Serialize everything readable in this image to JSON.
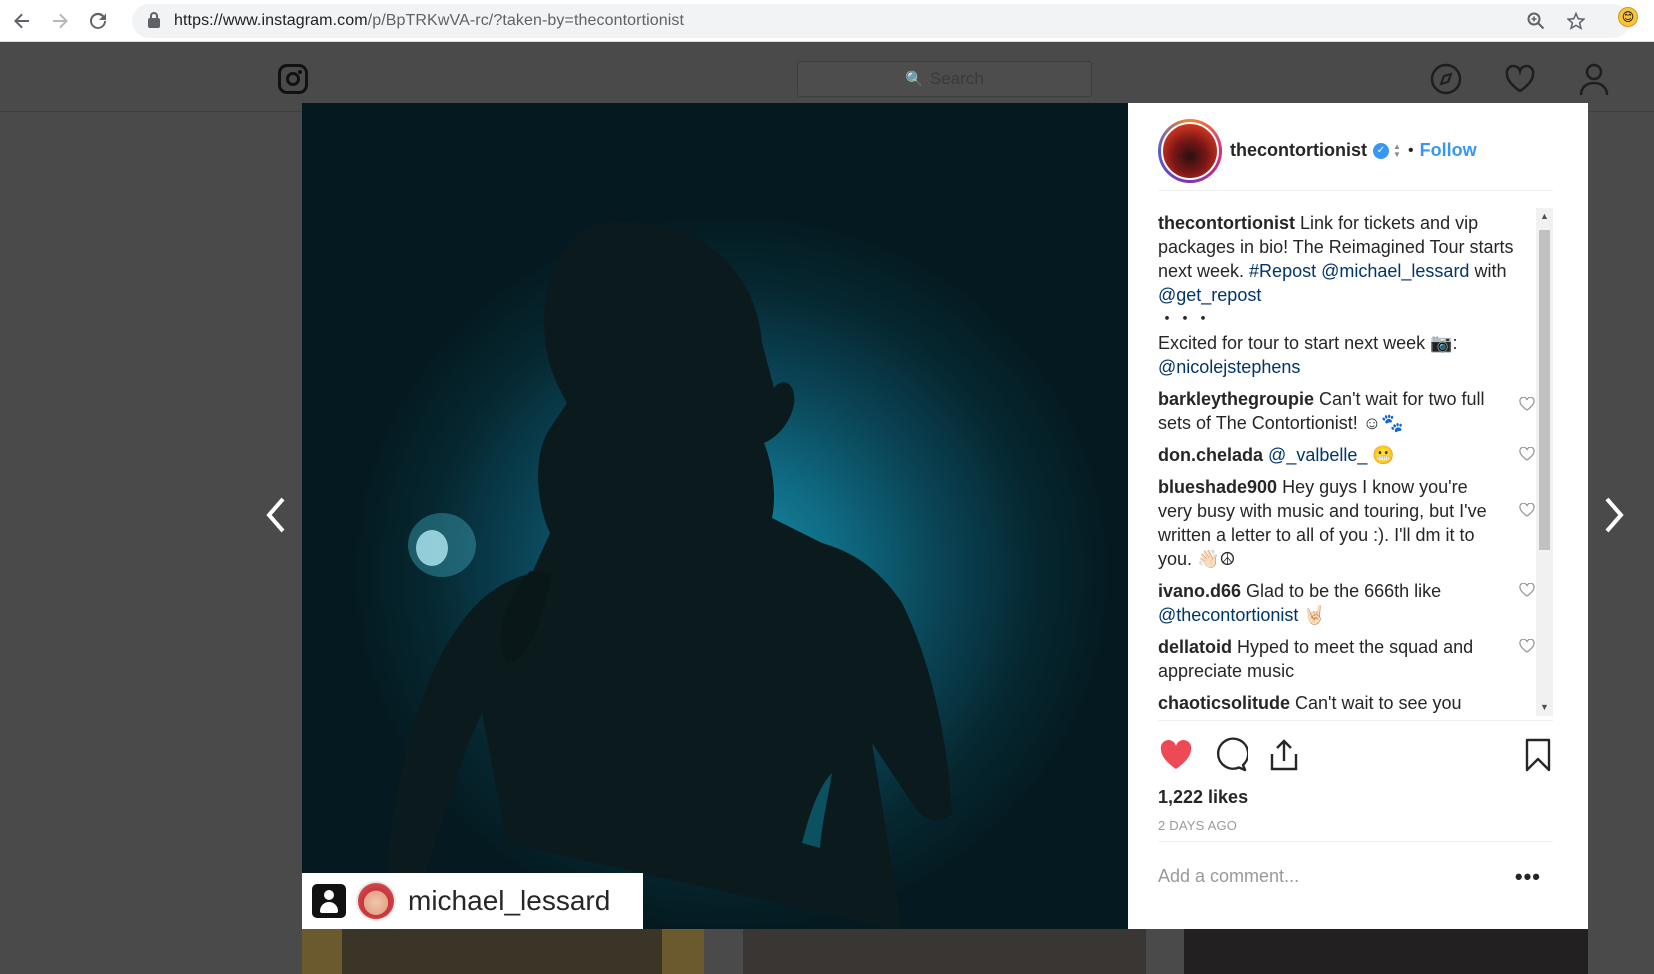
{
  "browser": {
    "url_host": "https://www.instagram.com",
    "url_path": "/p/BpTRKwVA-rc/?taken-by=thecontortionist",
    "icons": [
      "back-arrow-icon",
      "forward-arrow-icon",
      "reload-icon",
      "lock-icon",
      "zoom-icon",
      "star-icon",
      "emoji-extension-icon"
    ]
  },
  "header": {
    "search_placeholder": "Search"
  },
  "photo": {
    "tagged_user": "michael_lessard"
  },
  "post": {
    "username": "thecontortionist",
    "follow_label": "Follow",
    "caption": {
      "user": "thecontortionist",
      "text1": " Link for tickets and vip packages in bio! The Reimagined Tour starts next week. ",
      "tag_repost": "#Repost",
      "sp": " ",
      "mention1": "@michael_lessard",
      "with": " with ",
      "mention2": "@get_repost",
      "dots": "・・・",
      "text2": "Excited for tour to start next week ",
      "camera": "📷",
      "colon": ": ",
      "mention3": "@nicolejstephens"
    },
    "comments": [
      {
        "user": "barkleythegroupie",
        "text": " Can't wait for two full sets of The Contortionist! ☺🐾"
      },
      {
        "user": "don.chelada",
        "mention": "@_valbelle_",
        "emoji": " 😬"
      },
      {
        "user": "blueshade900",
        "text": " Hey guys I know you're very busy with music and touring, but I've written a letter to all of you :). I'll dm it to you. 👋🏻☮"
      },
      {
        "user": "ivano.d66",
        "text": " Glad to be the 666th like ",
        "mention": "@thecontortionist",
        "tail": " 🤘🏻"
      },
      {
        "user": "dellatoid",
        "text": " Hyped to meet the squad and appreciate music"
      },
      {
        "user": "chaoticsolitude",
        "text": " Can't wait to see you"
      }
    ],
    "likes": "1,222 likes",
    "age": "2 DAYS AGO",
    "comment_placeholder": "Add a comment...",
    "more_label": "•••"
  },
  "colors": {
    "accent": "#3897f0",
    "like_red": "#ed4956",
    "overlay": "#4a4a4a"
  }
}
